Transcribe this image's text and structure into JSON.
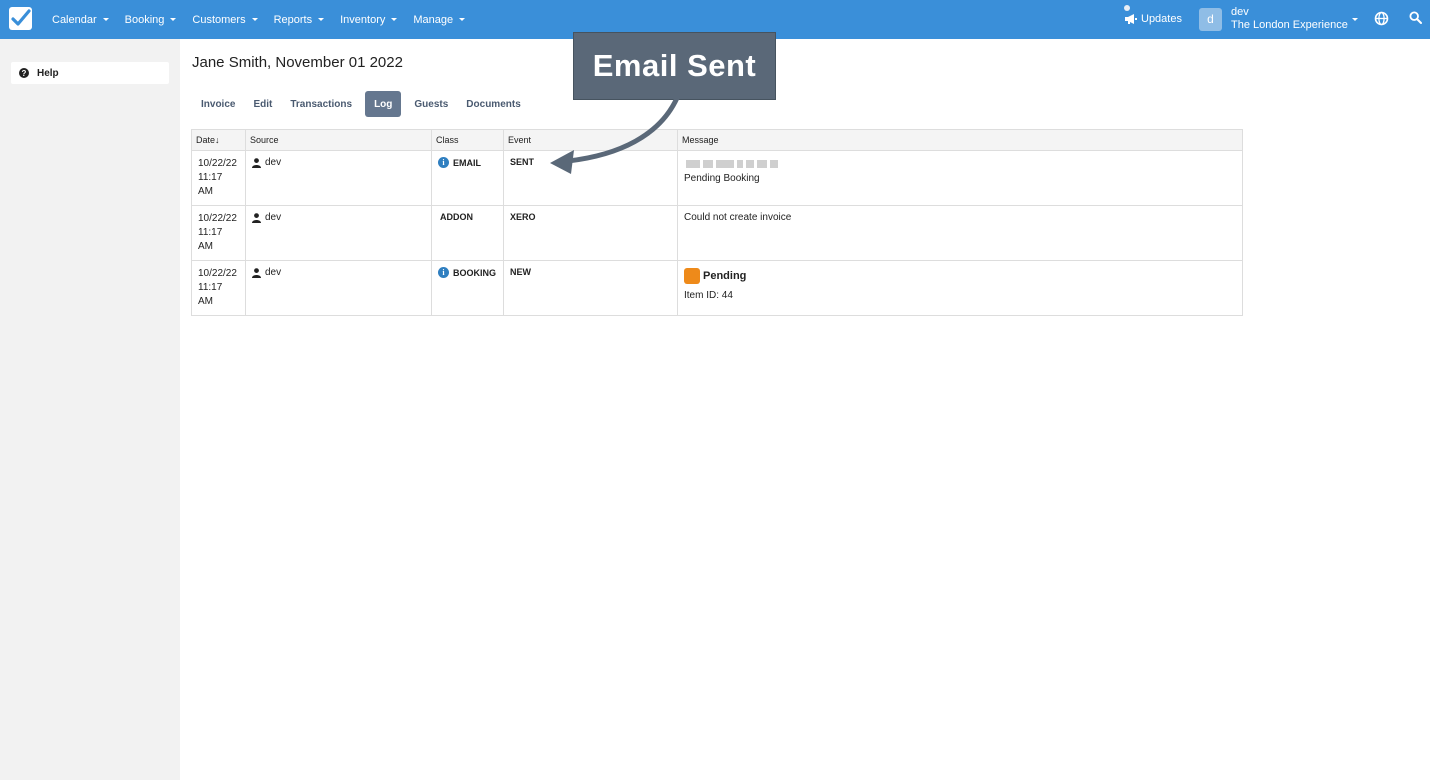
{
  "nav": {
    "menu": [
      "Calendar",
      "Booking",
      "Customers",
      "Reports",
      "Inventory",
      "Manage"
    ],
    "updates_label": "Updates",
    "user_initial": "d",
    "user_name": "dev",
    "user_org": "The London Experience",
    "accent_color": "#3a8fd9"
  },
  "sidebar": {
    "help_label": "Help"
  },
  "page": {
    "title": "Jane Smith, November 01 2022",
    "tabs": [
      "Invoice",
      "Edit",
      "Transactions",
      "Log",
      "Guests",
      "Documents"
    ],
    "active_tab": "Log"
  },
  "table": {
    "headers": [
      "Date↓",
      "Source",
      "Class",
      "Event",
      "Message"
    ],
    "rows": [
      {
        "date": "10/22/22",
        "time": "11:17 AM",
        "source": "dev",
        "class": "EMAIL",
        "class_icon": "info-icon",
        "event": "SENT",
        "message": "Pending Booking"
      },
      {
        "date": "10/22/22",
        "time": "11:17 AM",
        "source": "dev",
        "class": "ADDON",
        "class_icon": "",
        "event": "XERO",
        "message": "Could not create invoice"
      },
      {
        "date": "10/22/22",
        "time": "11:17 AM",
        "source": "dev",
        "class": "BOOKING",
        "class_icon": "info-icon",
        "event": "NEW",
        "message_badge": "Pending",
        "message_badge_color": "#ee8a1a",
        "message": "Item ID: 44"
      }
    ]
  },
  "callout": {
    "text": "Email Sent"
  }
}
